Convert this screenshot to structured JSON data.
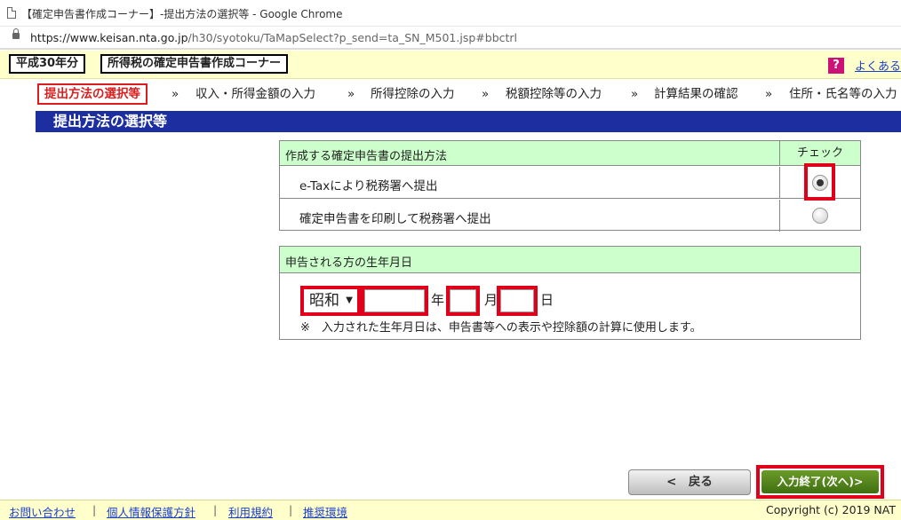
{
  "browser": {
    "title": "【確定申告書作成コーナー】-提出方法の選択等 - Google Chrome",
    "url_host": "https://www.keisan.nta.go.jp",
    "url_path": "/h30/syotoku/TaMapSelect?p_send=ta_SN_M501.jsp#bbctrl"
  },
  "header": {
    "year_badge": "平成30年分",
    "corner_title": "所得税の確定申告書作成コーナー",
    "help_icon": "?",
    "help_link": "よくある"
  },
  "steps": {
    "separator": "»",
    "items": [
      "提出方法の選択等",
      "収入・所得金額の入力",
      "所得控除の入力",
      "税額控除等の入力",
      "計算結果の確認",
      "住所・氏名等の入力"
    ]
  },
  "page_title": "提出方法の選択等",
  "submission": {
    "header_method": "作成する確定申告書の提出方法",
    "header_check": "チェック",
    "options": [
      {
        "label": "e-Taxにより税務署へ提出",
        "selected": true
      },
      {
        "label": "確定申告書を印刷して税務署へ提出",
        "selected": false
      }
    ]
  },
  "birth": {
    "header": "申告される方の生年月日",
    "era_value": "昭和",
    "era_arrow": "▼",
    "year_unit": "年",
    "month_unit": "月",
    "day_unit": "日",
    "year_value": "",
    "month_value": "",
    "day_value": "",
    "note": "※　入力された生年月日は、申告書等への表示や控除額の計算に使用します。"
  },
  "buttons": {
    "back": "<　戻る",
    "next": "入力終了(次へ)>"
  },
  "footer": {
    "links": [
      "お問い合わせ",
      "個人情報保護方針",
      "利用規約",
      "推奨環境"
    ],
    "separator": "|",
    "copyright": "Copyright (c) 2019 NAT"
  },
  "colors": {
    "highlight_red": "#e0001a",
    "title_blue": "#1c2ea0",
    "header_yellow": "#ffffcc",
    "table_header_green": "#ccffcc",
    "next_green": "#4f8019"
  }
}
